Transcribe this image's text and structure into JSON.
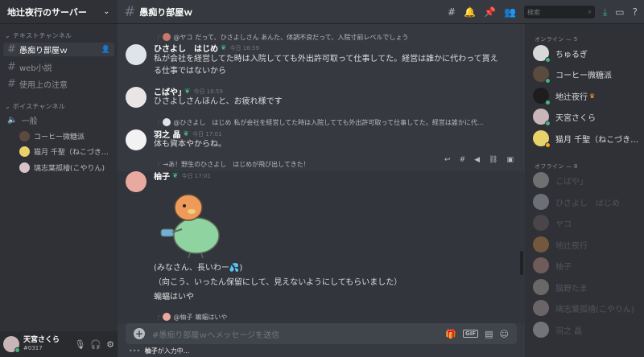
{
  "server": {
    "name": "地辻夜行のサーバー"
  },
  "categories": {
    "text": "テキストチャンネル",
    "voice": "ボイスチャンネル"
  },
  "text_channels": [
    {
      "name": "愚痴り部屋ｗ"
    },
    {
      "name": "web小説"
    },
    {
      "name": "使用上の注意"
    }
  ],
  "voice_channel": {
    "name": "一般",
    "users": [
      "コーヒー微糖派",
      "猫月 千聖（ねこづき…",
      "璃志葉孤檜(こやりん)"
    ]
  },
  "user_panel": {
    "name": "天宮さくら",
    "tag": "#0317"
  },
  "topbar": {
    "channel": "愚痴り部屋ｗ",
    "search_placeholder": "検索"
  },
  "messages": [
    {
      "reply_name": "@ヤコ",
      "reply_text": "だって、ひさよしさん あんた、体調不良だって、入院寸前レベルでしょう",
      "author": "ひさよし　はじめ",
      "time": "今日 16:59",
      "lines": [
        "私が会社を経営してた時は入院してても外出許可取って仕事してた。経営は誰かに代わって貰え",
        "る仕事ではないから"
      ]
    },
    {
      "author": "こばや｣",
      "time": "今日 16:59",
      "lines": [
        "ひさよしさんほんと、お疲れ様です"
      ]
    },
    {
      "reply_name": "@ひさよし　はじめ",
      "reply_text": "私が会社を経営してた時は入院してても外出許可取って仕事してた。経営は誰かに代...",
      "author": "羽之 晶",
      "time": "今日 17:01",
      "lines": [
        "体も資本やからね。"
      ]
    },
    {
      "reply_name": "→あ！野生のひさよし　はじめが飛び出してきた！",
      "reply_text": "",
      "author": "柚子",
      "time": "今日 17:01",
      "lines": [
        "(みなさん、長いわー💦)",
        "（向こう、いったん保留にして、見えないようにしてもらいました）",
        "蝙蝠はいや"
      ]
    },
    {
      "reply_name": "@柚子",
      "reply_text": "蝙蝠はいや"
    }
  ],
  "composer": {
    "placeholder": "#愚痴り部屋ｗへメッセージを送信",
    "gif": "GIF"
  },
  "typing": {
    "user": "柚子",
    "text": "が入力中..."
  },
  "member_list": {
    "online_header": "オンライン — 5",
    "offline_header": "オフライン — 8",
    "online": [
      "ちゅるぎ",
      "コーヒー微糖派",
      "地辻夜行",
      "天宮さくら",
      "猫月 千聖（ねこづき…"
    ],
    "offline": [
      "こばや｣",
      "ひさよし　はじめ",
      "ヤコ",
      "地辻夜行",
      "柚子",
      "猫野たま",
      "璃志葉孤檜(こやりん)",
      "羽之 晶"
    ]
  },
  "colors": {
    "accent": "#43b581",
    "background": "#36393f",
    "sidebar": "#2f3136"
  }
}
